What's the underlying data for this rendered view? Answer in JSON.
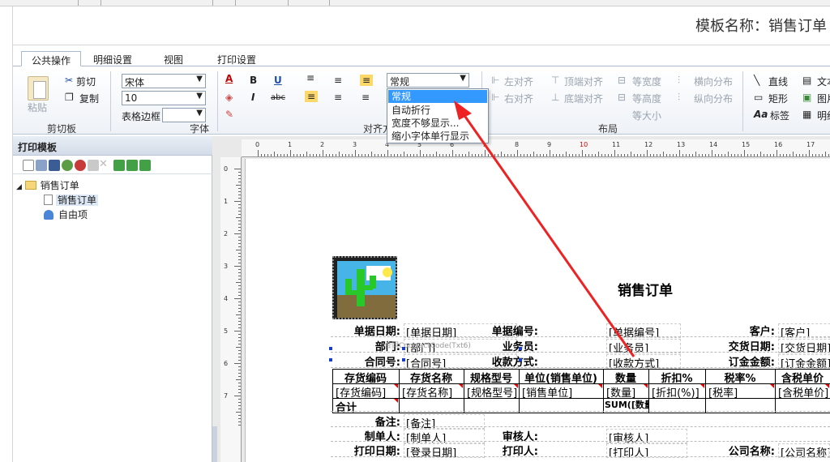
{
  "window": {
    "title": "模板名称：销售订单"
  },
  "ribbon": {
    "tabs": [
      {
        "label": "公共操作"
      },
      {
        "label": "明细设置"
      },
      {
        "label": "视图"
      },
      {
        "label": "打印设置"
      }
    ],
    "clipboard": {
      "label": "剪切板",
      "paste": "粘贴",
      "cut": "剪切",
      "copy": "复制"
    },
    "font": {
      "label": "字体",
      "font_name": "宋体",
      "font_size": "10",
      "border_label": "表格边框",
      "border_value": ""
    },
    "align": {
      "label": "对齐方式",
      "wrap_value": "常规"
    },
    "layout": {
      "label": "布局",
      "items": [
        "左对齐",
        "右对齐",
        "顶端对齐",
        "底端对齐",
        "等宽度",
        "等高度",
        "等大小",
        "横向分布",
        "纵向分布"
      ]
    },
    "insert": {
      "items": [
        "直线",
        "矩形",
        "标签",
        "文本",
        "图片",
        "明细"
      ]
    }
  },
  "wrap_dropdown": {
    "options": [
      "常规",
      "自动折行",
      "宽度不够显示...",
      "缩小字体单行显示"
    ],
    "selected": "常规"
  },
  "left_panel": {
    "title": "打印模板",
    "tree": {
      "root": "销售订单",
      "children": [
        "销售订单",
        "自由项"
      ]
    }
  },
  "ruler": {
    "top": [
      "0",
      "1",
      "2",
      "3",
      "4",
      "5",
      "6",
      "7",
      "8",
      "9",
      "10",
      "11",
      "12",
      "13",
      "14",
      "15",
      "16",
      "17"
    ],
    "left": [
      "0",
      "1",
      "2",
      "3",
      "4",
      "5",
      "6",
      "7"
    ]
  },
  "report": {
    "title": "销售订单",
    "header": [
      {
        "label": "单据日期:",
        "value": "[单据日期]"
      },
      {
        "label": "单据编号:",
        "value": "[单据编号]"
      },
      {
        "label": "客户:",
        "value": "[客户]"
      },
      {
        "label": "部门:",
        "value": "[部门]"
      },
      {
        "label": "业务员:",
        "value": "[业务员]"
      },
      {
        "label": "交货日期:",
        "value": "[交货日期]"
      },
      {
        "label": "合同号:",
        "value": "[合同号]"
      },
      {
        "label": "收款方式:",
        "value": "[收款方式]"
      },
      {
        "label": "订金金额:",
        "value": "[订金金额]"
      }
    ],
    "ghost_text": "合同ContractCode(Txt6)",
    "columns": [
      "存货编码",
      "存货名称",
      "规格型号",
      "单位(销售单位)",
      "数量",
      "折扣%",
      "税率%",
      "含税单价"
    ],
    "row": [
      "[存货编码]",
      "[存货名称]",
      "[规格型号]",
      "[销售单位]",
      "[数量]",
      "[折扣(%)]",
      "[税率]",
      "[含税单价]"
    ],
    "total_label": "合计",
    "total_sum": "SUM([数量])",
    "footer": [
      {
        "label": "备注:",
        "value": "[备注]"
      },
      {
        "label": "制单人:",
        "value": "[制单人]"
      },
      {
        "label": "审核人:",
        "value": "[审核人]"
      },
      {
        "label": "打印日期:",
        "value": "[登录日期]"
      },
      {
        "label": "打印人:",
        "value": "[打印人]"
      },
      {
        "label": "公司名称:",
        "value": "[公司名称]"
      }
    ]
  }
}
